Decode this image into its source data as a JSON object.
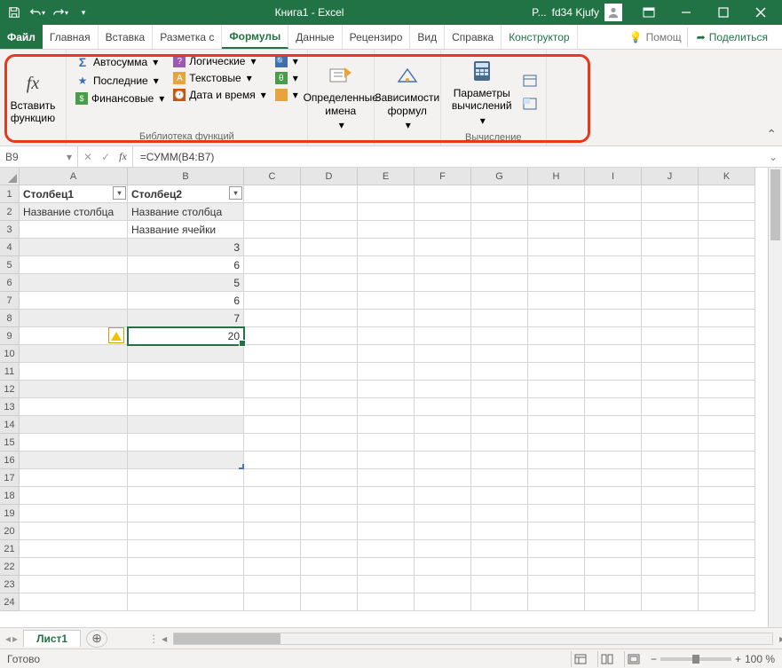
{
  "title": "Книга1  -  Excel",
  "user": {
    "short": "P...",
    "name": "fd34 Kjufy"
  },
  "tabs": [
    "Файл",
    "Главная",
    "Вставка",
    "Разметка с",
    "Формулы",
    "Данные",
    "Рецензиро",
    "Вид",
    "Справка",
    "Конструктор"
  ],
  "active_tab_index": 4,
  "help_label": "Помощ",
  "share_label": "Поделиться",
  "ribbon": {
    "insert_fn": {
      "label": "Вставить функцию"
    },
    "lib": {
      "autosum": "Автосумма",
      "recent": "Последние",
      "financial": "Финансовые",
      "logical": "Логические",
      "text": "Текстовые",
      "datetime": "Дата и время",
      "group_label": "Библиотека функций"
    },
    "names": {
      "label": "Определенные имена"
    },
    "deps": {
      "label": "Зависимости формул"
    },
    "calc": {
      "params": "Параметры вычислений",
      "group_label": "Вычисление"
    }
  },
  "namebox": "B9",
  "formula": "=СУММ(B4:B7)",
  "columns": [
    "A",
    "B",
    "C",
    "D",
    "E",
    "F",
    "G",
    "H",
    "I",
    "J",
    "K"
  ],
  "rows": 24,
  "table": {
    "header": [
      "Столбец1",
      "Столбец2"
    ],
    "a": [
      "Название столбца",
      "",
      "",
      "",
      "",
      "",
      "",
      ""
    ],
    "b": [
      "Название столбца",
      "Название ячейки",
      "3",
      "6",
      "5",
      "6",
      "7",
      "20"
    ]
  },
  "sheet": "Лист1",
  "status": "Готово",
  "zoom": "100 %"
}
